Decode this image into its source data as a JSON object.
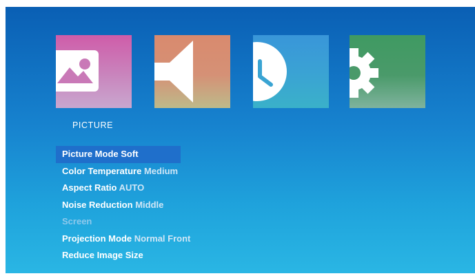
{
  "categories": [
    {
      "id": "picture",
      "label": "PICTURE",
      "icon": "picture-icon"
    },
    {
      "id": "sound",
      "icon": "speaker-icon"
    },
    {
      "id": "time",
      "icon": "clock-icon"
    },
    {
      "id": "setup",
      "icon": "gear-icon"
    }
  ],
  "selected_category_label": "PICTURE",
  "menu": [
    {
      "label": "Picture Mode",
      "value": "Soft",
      "selected": true
    },
    {
      "label": "Color Temperature",
      "value": "Medium"
    },
    {
      "label": "Aspect Ratio",
      "value": "AUTO"
    },
    {
      "label": "Noise Reduction",
      "value": "Middle"
    },
    {
      "label": "Screen",
      "value": "",
      "disabled": true
    },
    {
      "label": "Projection Mode",
      "value": "Normal Front"
    },
    {
      "label": "Reduce Image Size",
      "value": ""
    }
  ],
  "colors": {
    "background_top": "#0a5fb4",
    "background_bottom": "#2ab6e4",
    "selection": "#1f6fcb"
  }
}
